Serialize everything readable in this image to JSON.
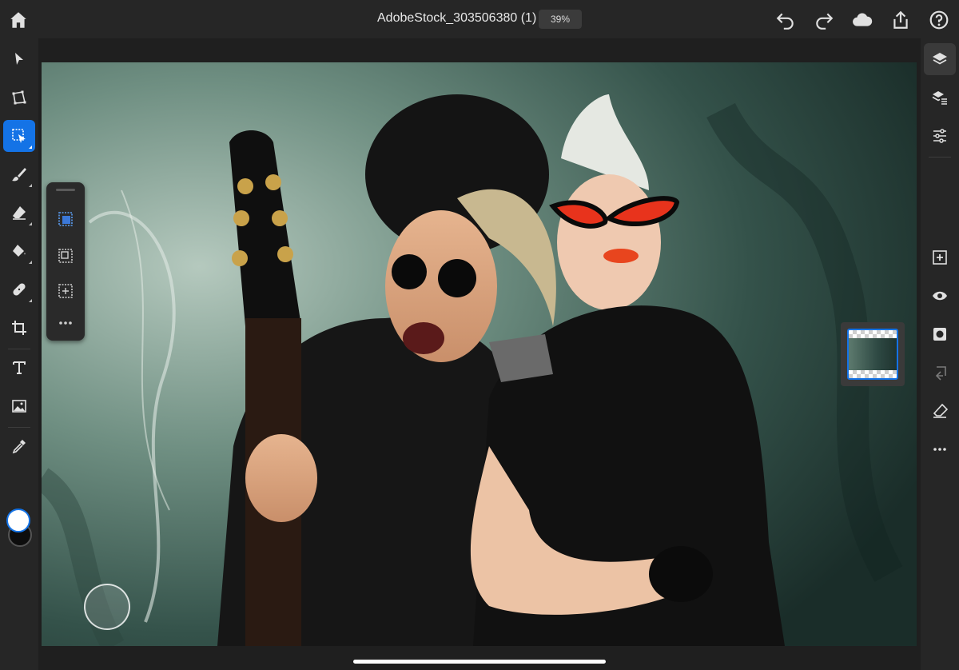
{
  "document": {
    "title": "AdobeStock_303506380 (1)",
    "zoom": "39%"
  },
  "topbar_icons": [
    "home-icon",
    "undo-icon",
    "redo-icon",
    "cloud-icon",
    "share-icon",
    "help-icon"
  ],
  "left_tools": [
    {
      "name": "select",
      "icon": "arrow-pointer-icon"
    },
    {
      "name": "transform",
      "icon": "transform-icon"
    },
    {
      "name": "selection",
      "icon": "selection-icon",
      "active": true
    },
    {
      "name": "brush",
      "icon": "brush-icon"
    },
    {
      "name": "eraser",
      "icon": "eraser-icon"
    },
    {
      "name": "fill",
      "icon": "paint-bucket-icon"
    },
    {
      "name": "healing",
      "icon": "bandage-icon"
    },
    {
      "name": "crop",
      "icon": "crop-icon"
    },
    {
      "name": "type",
      "icon": "type-icon"
    },
    {
      "name": "place-image",
      "icon": "image-icon"
    },
    {
      "name": "eyedropper",
      "icon": "eyedropper-icon"
    }
  ],
  "selection_flyout": [
    "subject-select-icon",
    "lasso-select-icon",
    "rect-select-icon",
    "more-icon"
  ],
  "right_tools": [
    {
      "name": "layers",
      "icon": "layers-icon",
      "active": true
    },
    {
      "name": "layer-properties",
      "icon": "layer-properties-icon"
    },
    {
      "name": "adjustments",
      "icon": "sliders-icon"
    },
    {
      "name": "add-layer",
      "icon": "add-layer-icon"
    },
    {
      "name": "visibility",
      "icon": "eye-icon"
    },
    {
      "name": "mask",
      "icon": "mask-icon"
    },
    {
      "name": "merge",
      "icon": "merge-icon"
    },
    {
      "name": "clear",
      "icon": "eraser-layer-icon"
    },
    {
      "name": "more",
      "icon": "more-icon"
    }
  ],
  "colors": {
    "accent": "#1473e6",
    "foreground_swatch": "#ffffff",
    "background_swatch": "#0d0d0d",
    "toolbar_bg": "#262626"
  }
}
